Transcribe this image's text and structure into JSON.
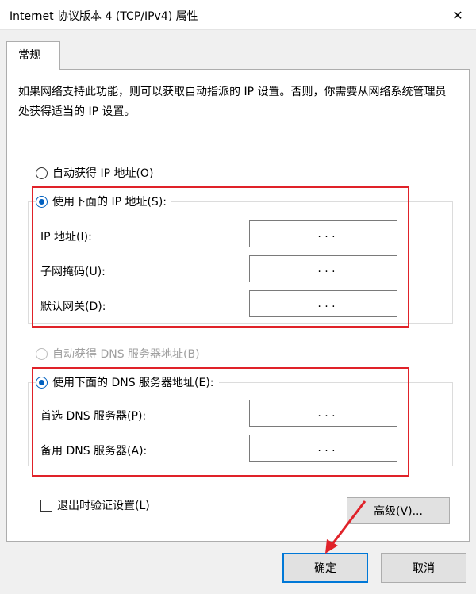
{
  "window": {
    "title": "Internet 协议版本 4 (TCP/IPv4) 属性",
    "close_glyph": "✕"
  },
  "tabs": [
    {
      "label": "常规",
      "selected": true
    }
  ],
  "info_text": "如果网络支持此功能，则可以获取自动指派的 IP 设置。否则，你需要从网络系统管理员处获得适当的 IP 设置。",
  "ip": {
    "auto_label": "自动获得 IP 地址(O)",
    "manual_label": "使用下面的 IP 地址(S):",
    "selected": "manual",
    "fields": [
      {
        "label": "IP 地址(I):",
        "value": ". . ."
      },
      {
        "label": "子网掩码(U):",
        "value": ". . ."
      },
      {
        "label": "默认网关(D):",
        "value": ". . ."
      }
    ]
  },
  "dns": {
    "auto_label": "自动获得 DNS 服务器地址(B)",
    "auto_disabled": true,
    "manual_label": "使用下面的 DNS 服务器地址(E):",
    "selected": "manual",
    "fields": [
      {
        "label": "首选 DNS 服务器(P):",
        "value": ". . ."
      },
      {
        "label": "备用 DNS 服务器(A):",
        "value": ". . ."
      }
    ]
  },
  "validate_checkbox": {
    "label": "退出时验证设置(L)",
    "checked": false
  },
  "buttons": {
    "advanced": "高级(V)...",
    "ok": "确定",
    "cancel": "取消"
  },
  "colors": {
    "highlight": "#e02229",
    "accent": "#0078d7"
  }
}
